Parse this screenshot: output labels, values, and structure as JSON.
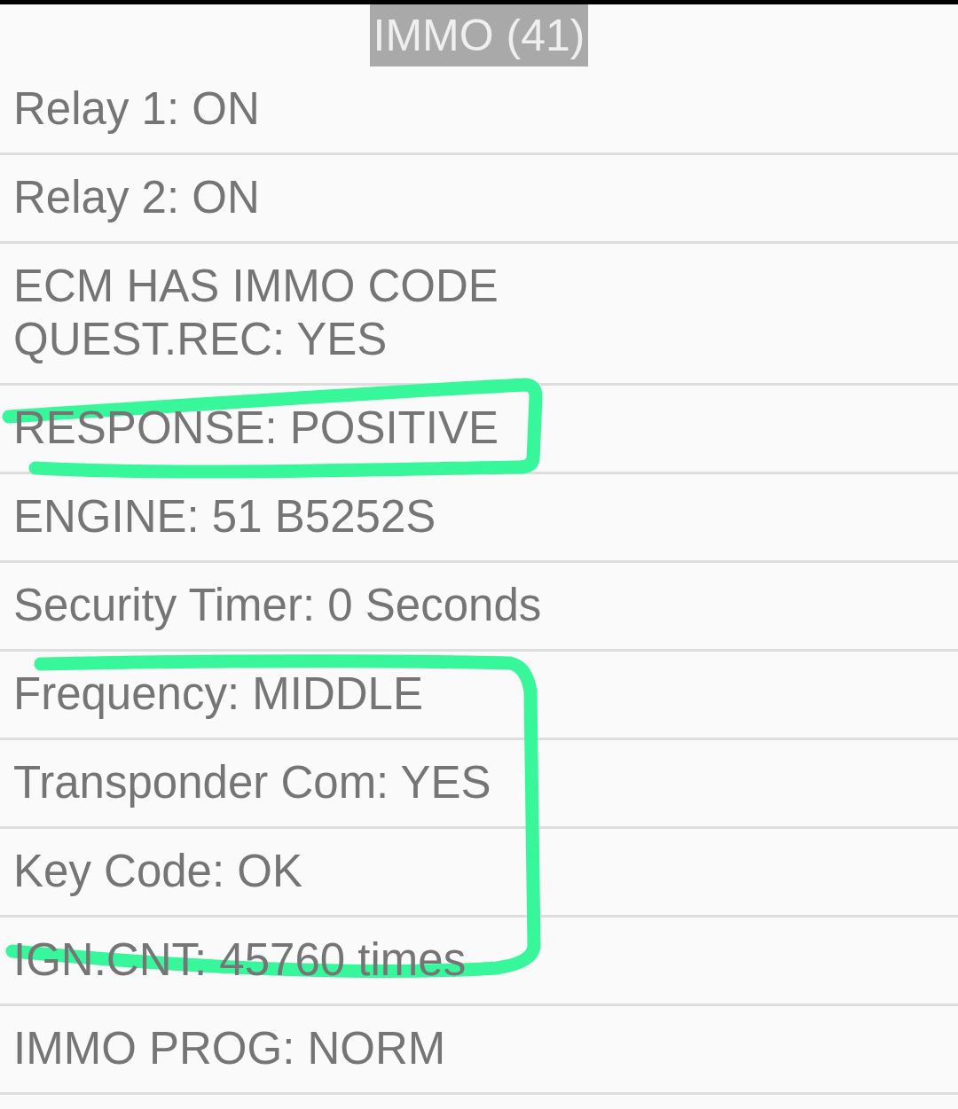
{
  "title": {
    "text": "IMMO (41)"
  },
  "rows": [
    {
      "text": "Relay 1: ON"
    },
    {
      "text": "Relay 2: ON"
    },
    {
      "text": "ECM HAS IMMO CODE\nQUEST.REC: YES"
    },
    {
      "text": "RESPONSE: POSITIVE"
    },
    {
      "text": "ENGINE: 51 B5252S"
    },
    {
      "text": "Security Timer: 0 Seconds"
    },
    {
      "text": "Frequency: MIDDLE"
    },
    {
      "text": "Transponder Com: YES"
    },
    {
      "text": "Key Code: OK"
    },
    {
      "text": "IGN.CNT: 45760 times"
    },
    {
      "text": "IMMO PROG: NORM"
    }
  ]
}
